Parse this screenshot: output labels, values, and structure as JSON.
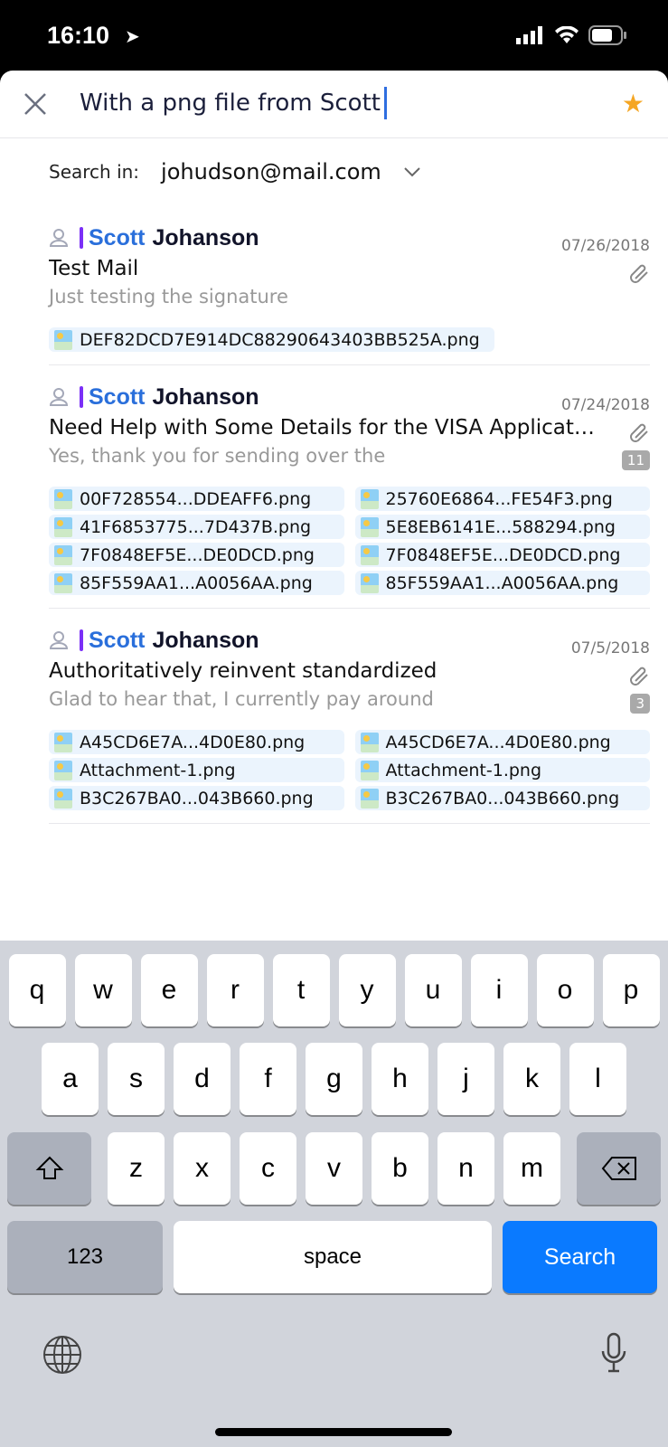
{
  "status": {
    "time": "16:10"
  },
  "search": {
    "query": "With a png file from Scott",
    "search_in_label": "Search in:",
    "account": "johudson@mail.com"
  },
  "results": [
    {
      "first": "Scott",
      "last": "Johanson",
      "date": "07/26/2018",
      "subject": "Test Mail",
      "preview": "Just testing the signature",
      "count": null,
      "attachments": [
        "DEF82DCD7E914DC88290643403BB525A.png"
      ]
    },
    {
      "first": "Scott",
      "last": "Johanson",
      "date": "07/24/2018",
      "subject": "Need Help with Some Details for the VISA Application",
      "preview": "Yes, thank you for sending over the",
      "count": "11",
      "attachments": [
        "00F728554...DDEAFF6.png",
        "25760E6864...FE54F3.png",
        "41F6853775...7D437B.png",
        "5E8EB6141E...588294.png",
        "7F0848EF5E...DE0DCD.png",
        "7F0848EF5E...DE0DCD.png",
        "85F559AA1...A0056AA.png",
        "85F559AA1...A0056AA.png"
      ]
    },
    {
      "first": "Scott",
      "last": "Johanson",
      "date": "07/5/2018",
      "subject": "Authoritatively reinvent standardized",
      "preview": "Glad to hear that, I currently pay around",
      "count": "3",
      "attachments": [
        "A45CD6E7A...4D0E80.png",
        "A45CD6E7A...4D0E80.png",
        "Attachment-1.png",
        "Attachment-1.png",
        "B3C267BA0...043B660.png",
        "B3C267BA0...043B660.png"
      ]
    }
  ],
  "keyboard": {
    "rows": [
      [
        "q",
        "w",
        "e",
        "r",
        "t",
        "y",
        "u",
        "i",
        "o",
        "p"
      ],
      [
        "a",
        "s",
        "d",
        "f",
        "g",
        "h",
        "j",
        "k",
        "l"
      ],
      [
        "z",
        "x",
        "c",
        "v",
        "b",
        "n",
        "m"
      ]
    ],
    "numbers": "123",
    "space": "space",
    "search": "Search"
  },
  "colors": {
    "accent": "#2a6fdb",
    "sender_bar": "#7b2ff7",
    "star": "#f5a623",
    "search_key": "#0a7aff"
  }
}
